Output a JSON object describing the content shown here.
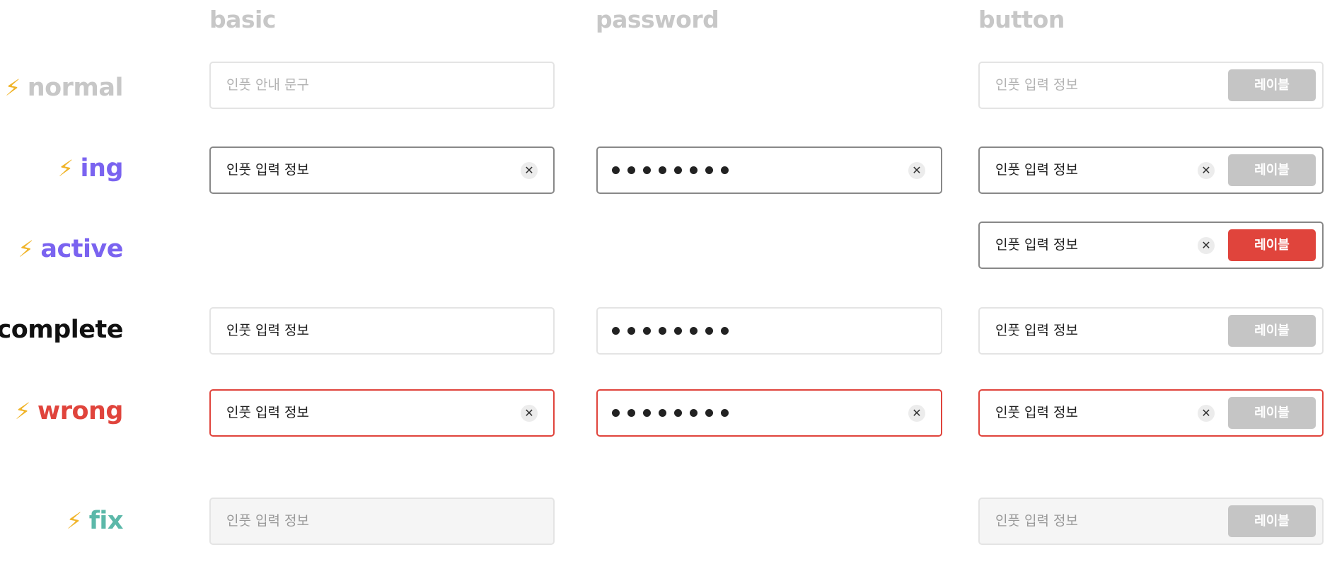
{
  "columns": {
    "basic": "basic",
    "password": "password",
    "button": "button"
  },
  "colors": {
    "bolt": "#f0b429",
    "normal": "#c7c7c7",
    "ing": "#7a63f0",
    "active": "#7a63f0",
    "complete": "#111111",
    "wrong": "#e0443c",
    "fix": "#5bb8a9",
    "button_default": "#c5c5c5",
    "button_active": "#e0443c"
  },
  "icons": {
    "state": "lightning-icon",
    "clear": "clear-icon"
  },
  "states": {
    "normal": "normal",
    "ing": "ing",
    "active": "active",
    "complete": "complete",
    "wrong": "wrong",
    "fix": "fix"
  },
  "bolt_glyph": "⚡",
  "clear_glyph": "✕",
  "placeholder": "인풋 안내 문구",
  "value": "인풋 입력 정보",
  "button_label": "레이블"
}
